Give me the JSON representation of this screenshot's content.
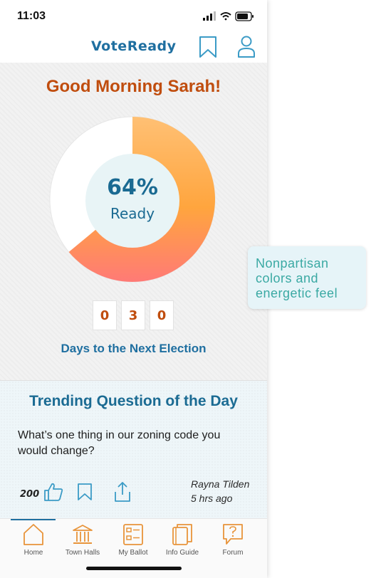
{
  "status_bar": {
    "time": "11:03",
    "icons": [
      "signal-icon",
      "wifi-icon",
      "battery-icon"
    ]
  },
  "header": {
    "brand": "VoteReady",
    "icons": [
      "bookmark-icon",
      "profile-icon"
    ]
  },
  "hero": {
    "greeting": "Good Morning Sarah!",
    "readiness": {
      "percent_text": "64%",
      "label": "Ready",
      "value": 0.64
    },
    "countdown_digits": [
      "0",
      "3",
      "0"
    ],
    "days_label": "Days to the Next Election"
  },
  "trending": {
    "title": "Trending Question of the Day",
    "question": "What’s one thing in our zoning code you would change?",
    "likes": "200",
    "author": "Rayna Tilden",
    "posted": "5 hrs ago",
    "icons": [
      "thumbs-up-icon",
      "bookmark-icon",
      "share-icon"
    ]
  },
  "tabs": [
    {
      "label": "Home",
      "icon": "home-icon",
      "active": true
    },
    {
      "label": "Town Halls",
      "icon": "town-hall-icon",
      "active": false
    },
    {
      "label": "My Ballot",
      "icon": "ballot-icon",
      "active": false
    },
    {
      "label": "Info Guide",
      "icon": "info-guide-icon",
      "active": false
    },
    {
      "label": "Forum",
      "icon": "forum-icon",
      "active": false
    }
  ],
  "callout": {
    "text": "Nonpartisan colors and energetic feel"
  },
  "colors": {
    "accent_blue": "#1f6fa0",
    "greeting_orange": "#c04d0e",
    "donut_start": "#ffc074",
    "donut_end": "#ff7a76",
    "icon_orange": "#e8943a",
    "callout_teal": "#3aa9a3"
  }
}
